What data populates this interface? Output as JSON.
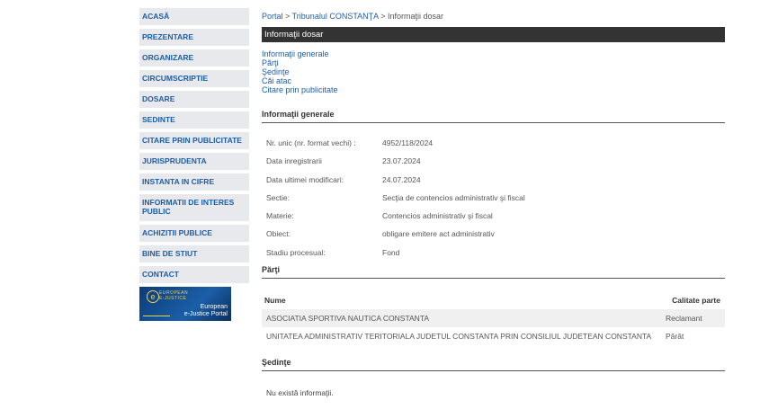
{
  "nav": [
    "ACASĂ",
    "PREZENTARE",
    "ORGANIZARE",
    "CIRCUMSCRIPTIE",
    "DOSARE",
    "SEDINTE",
    "CITARE PRIN PUBLICITATE",
    "JURISPRUDENTA",
    "INSTANTA IN CIFRE",
    "INFORMATII DE INTERES PUBLIC",
    "ACHIZITII PUBLICE",
    "BINE DE STIUT",
    "CONTACT"
  ],
  "ejustice": {
    "top": "EUROPEAN\nE-JUSTICE",
    "bottom": "European\ne-Justice Portal"
  },
  "breadcrumb": {
    "portal": "Portal",
    "sep": ">",
    "court": "Tribunalul CONSTANŢA",
    "current": "Informaţii dosar"
  },
  "title": "Informaţii dosar",
  "anchors": [
    "Informaţii generale",
    "Părţi",
    "Şedinţe",
    "Căi atac",
    "Citare prin publicitate"
  ],
  "general": {
    "heading": "Informaţii generale",
    "rows": [
      {
        "k": "Nr. unic (nr. format vechi) :",
        "v": "4952/118/2024"
      },
      {
        "k": "Data inregistrarii",
        "v": "23.07.2024"
      },
      {
        "k": "Data ultimei modificari:",
        "v": "24.07.2024"
      },
      {
        "k": "Sectie:",
        "v": "Secţia de contencios administrativ şi fiscal"
      },
      {
        "k": "Materie:",
        "v": "Contencios administrativ şi fiscal"
      },
      {
        "k": "Obiect:",
        "v": "obligare emitere act administrativ"
      },
      {
        "k": "Stadiu procesual:",
        "v": "Fond"
      }
    ]
  },
  "parti": {
    "heading": "Părţi",
    "col_name": "Nume",
    "col_quality": "Calitate parte",
    "rows": [
      {
        "name": "ASOCIATIA SPORTIVA NAUTICA CONSTANTA",
        "quality": "Reclamant"
      },
      {
        "name": "UNITATEA ADMINISTRATIV TERITORIALA JUDETUL CONSTANTA PRIN CONSILIUL JUDETEAN CONSTANTA",
        "quality": "Pârât"
      }
    ]
  },
  "sedinte": {
    "heading": "Şedinţe",
    "empty": "Nu există informaţii."
  }
}
